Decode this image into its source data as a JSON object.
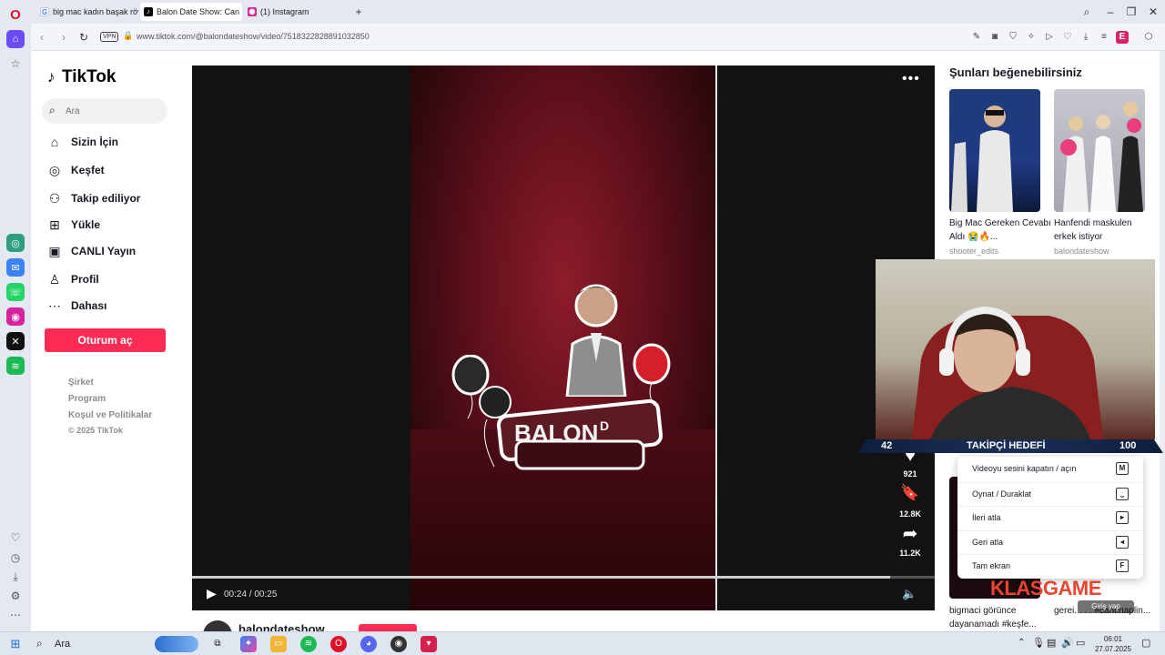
{
  "browser": {
    "tabs": [
      {
        "label": "big mac kadın başak röva"
      },
      {
        "label": "Balon Date Show: Can Cha"
      },
      {
        "label": "(1) Instagram"
      }
    ],
    "url": "www.tiktok.com/@balondateshow/video/7518322828891032850",
    "vpn_label": "VPN",
    "profile_initial": "E"
  },
  "tiktok": {
    "logo": "TikTok",
    "search_placeholder": "Ara",
    "nav": [
      {
        "label": "Sizin İçin",
        "icon": "home-icon"
      },
      {
        "label": "Keşfet",
        "icon": "compass-icon"
      },
      {
        "label": "Takip ediliyor",
        "icon": "following-icon"
      },
      {
        "label": "Yükle",
        "icon": "upload-icon"
      },
      {
        "label": "CANLI Yayın",
        "icon": "live-icon"
      },
      {
        "label": "Profil",
        "icon": "profile-icon"
      },
      {
        "label": "Dahası",
        "icon": "more-icon"
      }
    ],
    "login_button": "Oturum aç",
    "footer": [
      "Şirket",
      "Program",
      "Koşul ve Politikalar",
      "© 2025 TikTok"
    ]
  },
  "video": {
    "logo_text": "BALON",
    "logo_text_suffix": "D",
    "like_count": "921",
    "save_count": "12.8K",
    "share_count": "11.2K",
    "time": "00:24 / 00:25",
    "progress": 0.94,
    "author": "balondateshow"
  },
  "suggestions": {
    "title": "Şunları beğenebilirsiniz",
    "items": [
      {
        "title": "Big Mac Gereken Cevabı Aldı 😭🔥...",
        "user": "shooter_edits"
      },
      {
        "title": "Hanfendi maskulen erkek istiyor",
        "user": "balondateshow"
      }
    ],
    "bottom_items": [
      {
        "title": "bigmaci görünce dayanamadı #keşfe..."
      },
      {
        "title": "gerei... . . #canchaplin..."
      }
    ]
  },
  "overlay": {
    "goal_current": "42",
    "goal_label": "TAKİPÇİ HEDEFİ",
    "goal_target": "100",
    "brand": "KLASGAME",
    "login_hint": "Giriş yap"
  },
  "context_menu": [
    {
      "label": "Videoyu sesini kapatın / açın",
      "key": "M"
    },
    {
      "label": "Oynat / Duraklat",
      "key": "⎵"
    },
    {
      "label": "İleri atla",
      "key": "▸"
    },
    {
      "label": "Geri atla",
      "key": "◂"
    },
    {
      "label": "Tam ekran",
      "key": "F"
    }
  ],
  "taskbar": {
    "search_label": "Ara",
    "time": "06:01",
    "date": "27.07.2025"
  }
}
